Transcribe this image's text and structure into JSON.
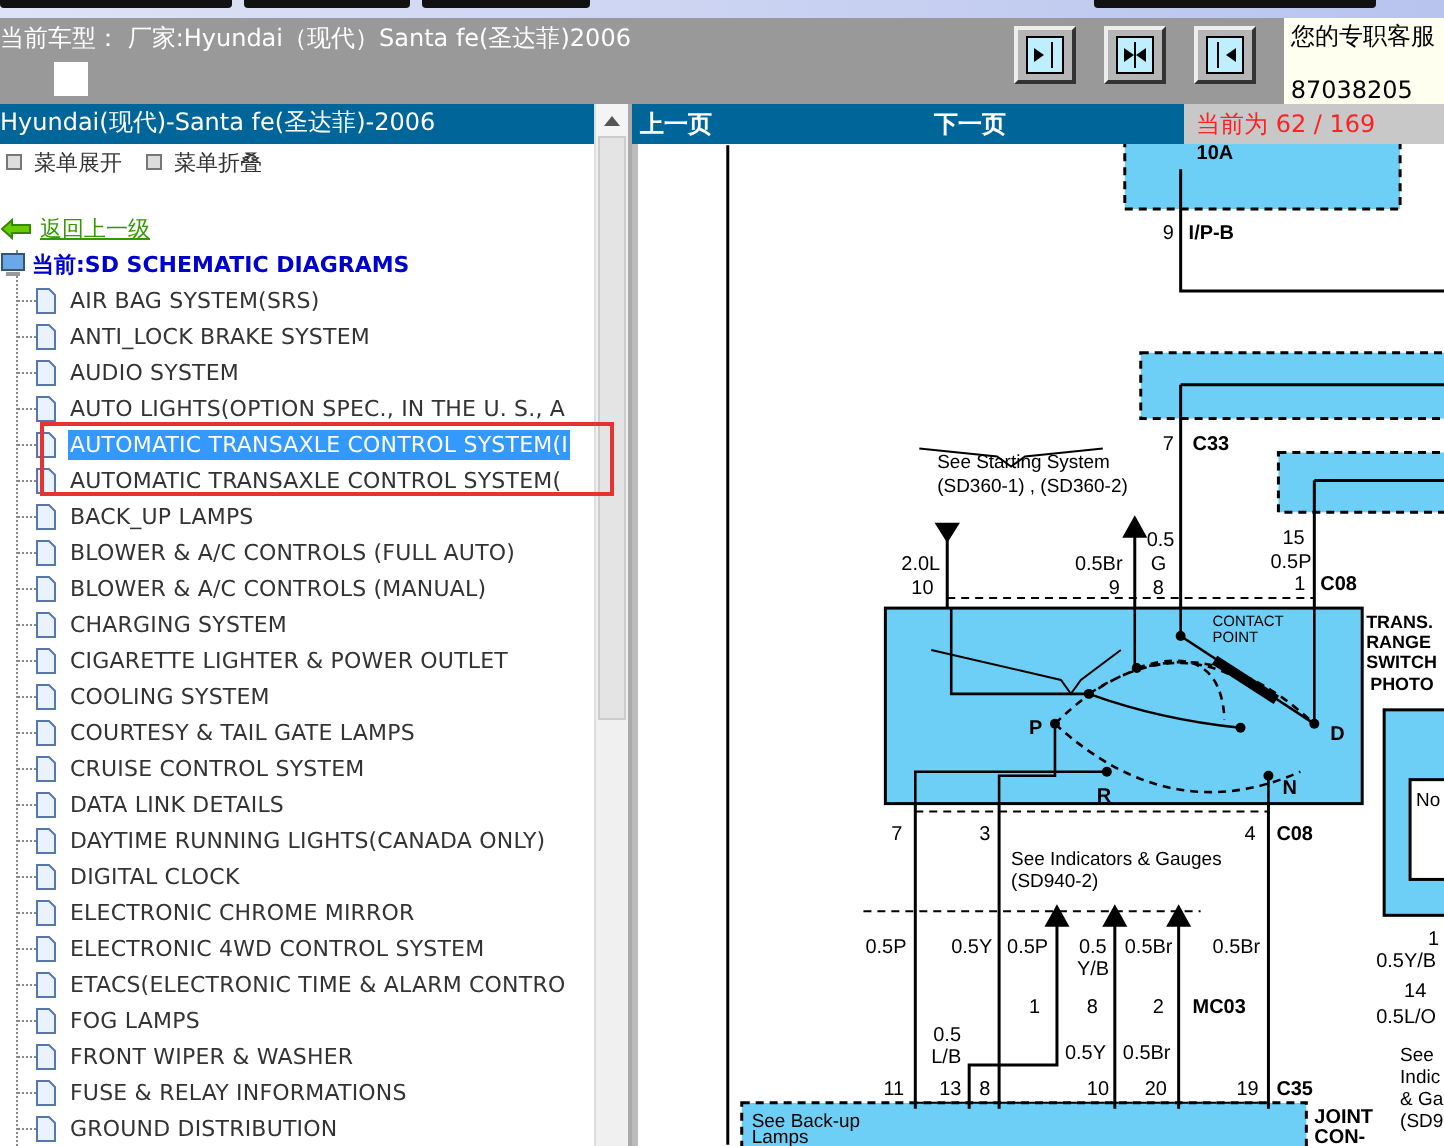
{
  "header": {
    "vehicle": "当前车型： 厂家:Hyundai（现代）Santa fe(圣达菲)2006",
    "service": {
      "title": "您的专职客服",
      "phone": "87038205"
    }
  },
  "tree_panel": {
    "title": "Hyundai(现代)-Santa fe(圣达菲)-2006",
    "actions": [
      "菜单展开",
      "菜单折叠"
    ],
    "back_link": "返回上一级",
    "current": "当前:SD SCHEMATIC DIAGRAMS",
    "items": [
      {
        "label": "AIR BAG SYSTEM(SRS)",
        "selected": false
      },
      {
        "label": "ANTI_LOCK BRAKE SYSTEM",
        "selected": false
      },
      {
        "label": "AUDIO SYSTEM",
        "selected": false
      },
      {
        "label": "AUTO LIGHTS(OPTION SPEC., IN THE U. S., A",
        "selected": false
      },
      {
        "label": "AUTOMATIC TRANSAXLE CONTROL SYSTEM(I",
        "selected": true
      },
      {
        "label": "AUTOMATIC TRANSAXLE CONTROL SYSTEM(",
        "selected": false
      },
      {
        "label": "BACK_UP LAMPS",
        "selected": false
      },
      {
        "label": "BLOWER & A/C CONTROLS (FULL AUTO)",
        "selected": false
      },
      {
        "label": "BLOWER & A/C CONTROLS (MANUAL)",
        "selected": false
      },
      {
        "label": "CHARGING SYSTEM",
        "selected": false
      },
      {
        "label": "CIGARETTE LIGHTER & POWER OUTLET",
        "selected": false
      },
      {
        "label": "COOLING SYSTEM",
        "selected": false
      },
      {
        "label": "COURTESY & TAIL GATE LAMPS",
        "selected": false
      },
      {
        "label": "CRUISE CONTROL SYSTEM",
        "selected": false
      },
      {
        "label": "DATA LINK DETAILS",
        "selected": false
      },
      {
        "label": "DAYTIME RUNNING LIGHTS(CANADA ONLY)",
        "selected": false
      },
      {
        "label": "DIGITAL CLOCK",
        "selected": false
      },
      {
        "label": "ELECTRONIC CHROME MIRROR",
        "selected": false
      },
      {
        "label": "ELECTRONIC 4WD CONTROL SYSTEM",
        "selected": false
      },
      {
        "label": "ETACS(ELECTRONIC TIME & ALARM CONTRO",
        "selected": false
      },
      {
        "label": "FOG LAMPS",
        "selected": false
      },
      {
        "label": "FRONT WIPER & WASHER",
        "selected": false
      },
      {
        "label": "FUSE & RELAY INFORMATIONS",
        "selected": false
      },
      {
        "label": "GROUND DISTRIBUTION",
        "selected": false
      }
    ]
  },
  "viewer": {
    "prev": "上一页",
    "next": "下一页",
    "page_status": "当前为 62 / 169",
    "diagram": {
      "labels": [
        {
          "text": "10A",
          "kind": "connector"
        },
        {
          "text": "9",
          "kind": "pin"
        },
        {
          "text": "I/P-B",
          "kind": "connector"
        },
        {
          "text": "7",
          "kind": "pin"
        },
        {
          "text": "C33",
          "kind": "connector"
        },
        {
          "text": "See Starting System",
          "kind": "note"
        },
        {
          "text": "(SD360-1) , (SD360-2)",
          "kind": "note"
        },
        {
          "text": "15",
          "kind": "pin"
        },
        {
          "text": "0.5P",
          "kind": "pin"
        },
        {
          "text": "1",
          "kind": "pin"
        },
        {
          "text": "C08",
          "kind": "connector"
        },
        {
          "text": "2.0L",
          "kind": "pin"
        },
        {
          "text": "10",
          "kind": "pin"
        },
        {
          "text": "0.5Br",
          "kind": "pin"
        },
        {
          "text": "9",
          "kind": "pin"
        },
        {
          "text": "0.5",
          "kind": "pin"
        },
        {
          "text": "G",
          "kind": "pin"
        },
        {
          "text": "8",
          "kind": "pin"
        },
        {
          "text": "TRANS.",
          "kind": "heading"
        },
        {
          "text": "RANGE",
          "kind": "heading"
        },
        {
          "text": "SWITCH",
          "kind": "heading"
        },
        {
          "text": "PHOTO",
          "kind": "heading"
        },
        {
          "text": "CONTACT",
          "kind": "small"
        },
        {
          "text": "POINT",
          "kind": "small"
        },
        {
          "text": "P",
          "kind": "connector"
        },
        {
          "text": "D",
          "kind": "connector"
        },
        {
          "text": "R",
          "kind": "connector"
        },
        {
          "text": "N",
          "kind": "connector"
        },
        {
          "text": "7",
          "kind": "pin"
        },
        {
          "text": "3",
          "kind": "pin"
        },
        {
          "text": "4",
          "kind": "pin"
        },
        {
          "text": "C08",
          "kind": "connector"
        },
        {
          "text": "See Indicators & Gauges",
          "kind": "note"
        },
        {
          "text": "(SD940-2)",
          "kind": "note"
        },
        {
          "text": "0.5P",
          "kind": "pin"
        },
        {
          "text": "0.5Y",
          "kind": "pin"
        },
        {
          "text": "0.5P",
          "kind": "pin"
        },
        {
          "text": "0.5",
          "kind": "pin"
        },
        {
          "text": "Y/B",
          "kind": "pin"
        },
        {
          "text": "0.5Br",
          "kind": "pin"
        },
        {
          "text": "0.5Br",
          "kind": "pin"
        },
        {
          "text": "1",
          "kind": "pin"
        },
        {
          "text": "8",
          "kind": "pin"
        },
        {
          "text": "2",
          "kind": "pin"
        },
        {
          "text": "MC03",
          "kind": "connector"
        },
        {
          "text": "0.5",
          "kind": "pin"
        },
        {
          "text": "L/B",
          "kind": "pin"
        },
        {
          "text": "0.5Y",
          "kind": "pin"
        },
        {
          "text": "0.5Br",
          "kind": "pin"
        },
        {
          "text": "11",
          "kind": "pin"
        },
        {
          "text": "13",
          "kind": "pin"
        },
        {
          "text": "8",
          "kind": "pin"
        },
        {
          "text": "10",
          "kind": "pin"
        },
        {
          "text": "20",
          "kind": "pin"
        },
        {
          "text": "19",
          "kind": "pin"
        },
        {
          "text": "C35",
          "kind": "connector"
        },
        {
          "text": "See Back-up",
          "kind": "note"
        },
        {
          "text": "Lamps",
          "kind": "note"
        },
        {
          "text": "JOINT",
          "kind": "connector"
        },
        {
          "text": "CON-",
          "kind": "connector"
        },
        {
          "text": "No",
          "kind": "note"
        },
        {
          "text": "1",
          "kind": "pin"
        },
        {
          "text": "0.5Y/B",
          "kind": "pin"
        },
        {
          "text": "14",
          "kind": "pin"
        },
        {
          "text": "0.5L/O",
          "kind": "pin"
        },
        {
          "text": "See",
          "kind": "note"
        },
        {
          "text": "Indic",
          "kind": "note"
        },
        {
          "text": "& Ga",
          "kind": "note"
        },
        {
          "text": "(SD9",
          "kind": "note"
        }
      ]
    }
  }
}
